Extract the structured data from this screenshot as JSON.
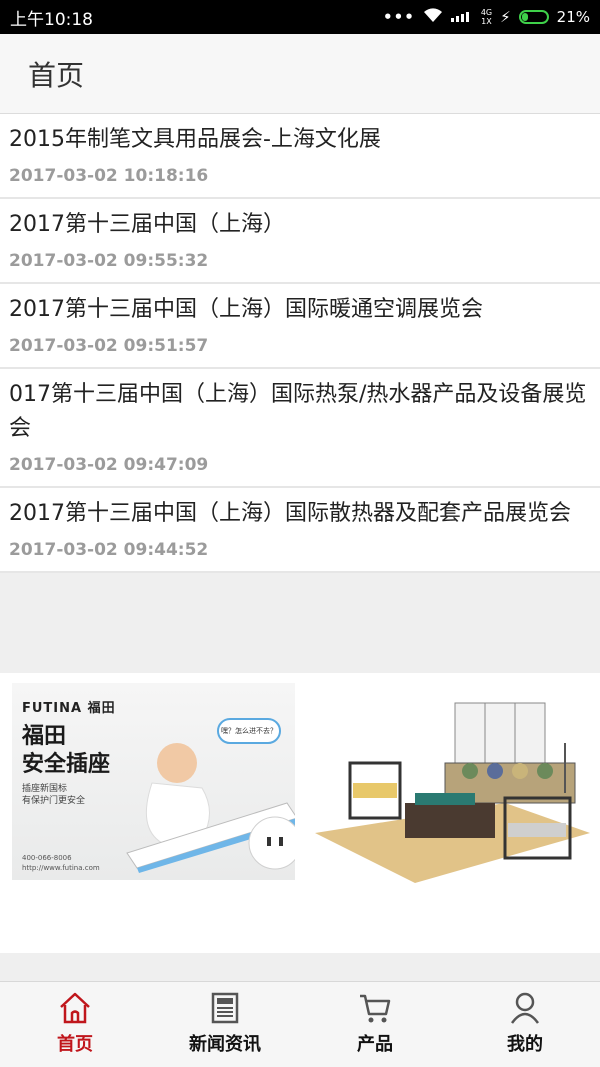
{
  "status": {
    "time": "上午10:18",
    "network_top": "4G",
    "network_bottom": "1X",
    "battery": "21%"
  },
  "header": {
    "title": "首页"
  },
  "news": [
    {
      "title": "2015年制笔文具用品展会-上海文化展",
      "date": "2017-03-02 10:18:16"
    },
    {
      "title": "2017第十三届中国（上海）",
      "date": "2017-03-02 09:55:32"
    },
    {
      "title": "2017第十三届中国（上海）国际暖通空调展览会",
      "date": "2017-03-02 09:51:57"
    },
    {
      "title": "017第十三届中国（上海）国际热泵/热水器产品及设备展览会",
      "date": "2017-03-02 09:47:09"
    },
    {
      "title": "2017第十三届中国（上海）国际散热器及配套产品展览会",
      "date": "2017-03-02 09:44:52"
    }
  ],
  "banner": {
    "ad1": {
      "brand": "FUTINA 福田",
      "headline_1": "福田",
      "headline_2": "安全插座",
      "sub_1": "插座新国标",
      "sub_2": "有保护门更安全",
      "bubble": "嘿？怎么进不去？",
      "contact_1": "400-066-8006",
      "contact_2": "http://www.futina.com"
    }
  },
  "tabs": [
    {
      "label": "首页",
      "icon": "home-icon",
      "active": true
    },
    {
      "label": "新闻资讯",
      "icon": "newspaper-icon",
      "active": false
    },
    {
      "label": "产品",
      "icon": "cart-icon",
      "active": false
    },
    {
      "label": "我的",
      "icon": "user-icon",
      "active": false
    }
  ],
  "colors": {
    "accent": "#c0161c",
    "statusbar": "#000000",
    "battery": "#3fd14a"
  }
}
